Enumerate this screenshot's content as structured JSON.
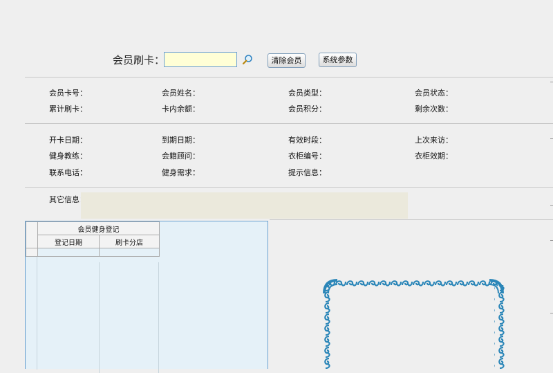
{
  "swipe": {
    "label": "会员刷卡：",
    "value": ""
  },
  "buttons": {
    "clear": "清除会员",
    "params": "系统参数"
  },
  "info": {
    "card_no": "会员卡号：",
    "name": "会员姓名：",
    "type": "会员类型：",
    "status": "会员状态：",
    "total_swipes": "累计刷卡：",
    "balance": "卡内余额：",
    "points": "会员积分：",
    "remaining": "剩余次数：",
    "open_date": "开卡日期：",
    "expire_date": "到期日期：",
    "valid_period": "有效时段：",
    "last_visit": "上次来访：",
    "coach": "健身教练：",
    "consultant": "会籍顾问：",
    "locker_no": "衣柜编号：",
    "locker_expire": "衣柜效期：",
    "phone": "联系电话：",
    "fitness_need": "健身需求：",
    "hint": "提示信息：",
    "other": "其它信息："
  },
  "grid": {
    "title": "会员健身登记",
    "columns": [
      "登记日期",
      "刷卡分店"
    ]
  }
}
